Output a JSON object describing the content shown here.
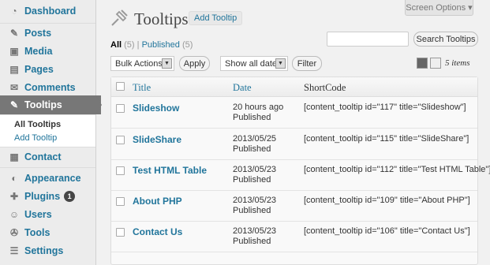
{
  "sidebar": {
    "items": [
      {
        "label": "Dashboard",
        "icon": "dashboard-icon",
        "glyph": "◔"
      },
      {
        "label": "Posts",
        "icon": "pushpin-icon",
        "glyph": "✎"
      },
      {
        "label": "Media",
        "icon": "media-icon",
        "glyph": "▣"
      },
      {
        "label": "Pages",
        "icon": "pages-icon",
        "glyph": "▤"
      },
      {
        "label": "Comments",
        "icon": "comments-icon",
        "glyph": "✉"
      },
      {
        "label": "Tooltips",
        "icon": "tooltips-icon",
        "glyph": "✎"
      },
      {
        "label": "Contact",
        "icon": "contact-icon",
        "glyph": "▦"
      },
      {
        "label": "Appearance",
        "icon": "appearance-icon",
        "glyph": "◐"
      },
      {
        "label": "Plugins",
        "icon": "plugins-icon",
        "glyph": "✚",
        "badge": "1"
      },
      {
        "label": "Users",
        "icon": "users-icon",
        "glyph": "☺"
      },
      {
        "label": "Tools",
        "icon": "tools-icon",
        "glyph": "✇"
      },
      {
        "label": "Settings",
        "icon": "settings-icon",
        "glyph": "☰"
      }
    ],
    "submenu": {
      "all": "All Tooltips",
      "add": "Add Tooltip"
    }
  },
  "header": {
    "screen_options": "Screen Options ▾",
    "title": "Tooltips",
    "add_button": "Add Tooltip"
  },
  "filters": {
    "all_label": "All",
    "all_count": "(5)",
    "separator": "|",
    "published_label": "Published",
    "published_count": "(5)"
  },
  "search": {
    "placeholder": "",
    "button": "Search Tooltips"
  },
  "toolbar": {
    "bulk_actions": "Bulk Actions",
    "apply": "Apply",
    "dates": "Show all dates",
    "filter": "Filter",
    "items_count": "5 items"
  },
  "table": {
    "columns": [
      "Title",
      "Date",
      "ShortCode"
    ],
    "rows": [
      {
        "title": "Slideshow",
        "date": "20 hours ago",
        "status": "Published",
        "shortcode": "[content_tooltip id=\"117\" title=\"Slideshow\"]"
      },
      {
        "title": "SlideShare",
        "date": "2013/05/25",
        "status": "Published",
        "shortcode": "[content_tooltip id=\"115\" title=\"SlideShare\"]"
      },
      {
        "title": "Test HTML Table",
        "date": "2013/05/23",
        "status": "Published",
        "shortcode": "[content_tooltip id=\"112\" title=\"Test HTML Table\"]"
      },
      {
        "title": "About PHP",
        "date": "2013/05/23",
        "status": "Published",
        "shortcode": "[content_tooltip id=\"109\" title=\"About PHP\"]"
      },
      {
        "title": "Contact Us",
        "date": "2013/05/23",
        "status": "Published",
        "shortcode": "[content_tooltip id=\"106\" title=\"Contact Us\"]"
      }
    ]
  },
  "colors": {
    "link": "#21759b",
    "active_menu": "#777777",
    "sidebar_bg": "#ececec"
  }
}
